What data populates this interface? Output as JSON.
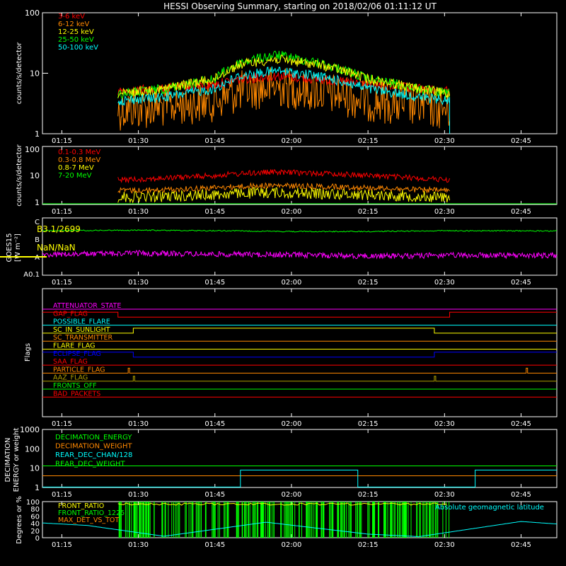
{
  "title": "HESSI Observing Summary, starting on 2018/02/06 01:11:12 UT",
  "time_ticks": [
    "01:15",
    "01:30",
    "01:45",
    "02:00",
    "02:15",
    "02:30",
    "02:45"
  ],
  "colors": {
    "red": "#ff0000",
    "orange": "#ff8800",
    "yellow": "#ffff00",
    "green": "#00ff00",
    "cyan": "#00ffff",
    "magenta": "#ff00ff",
    "blue": "#0000ff",
    "olive": "#b0a000",
    "white": "#ffffff"
  },
  "panel1": {
    "ylabel": "counts/s/detector",
    "yticks": [
      "100",
      "10",
      "1"
    ],
    "legend": [
      {
        "label": "3-6 keV",
        "color": "#ff0000"
      },
      {
        "label": "6-12 keV",
        "color": "#ff8800"
      },
      {
        "label": "12-25 keV",
        "color": "#ffff00"
      },
      {
        "label": "25-50 keV",
        "color": "#00ff00"
      },
      {
        "label": "50-100 keV",
        "color": "#00ffff"
      }
    ]
  },
  "panel2": {
    "ylabel": "counts/s/detector",
    "yticks": [
      "100",
      "10",
      "1"
    ],
    "legend": [
      {
        "label": "0.1-0.3 MeV",
        "color": "#ff0000"
      },
      {
        "label": "0.3-0.8 MeV",
        "color": "#ff8800"
      },
      {
        "label": "0.8-7 MeV",
        "color": "#ffff00"
      },
      {
        "label": "7-20 MeV",
        "color": "#00ff00"
      }
    ]
  },
  "panel3": {
    "ylabel": "GOES15",
    "ylabel2": "[W m⁻²]",
    "yticks": [
      "C",
      "B",
      "A",
      "A0.1"
    ],
    "label1": "B3.1/2699",
    "label2": "NaN/NaN"
  },
  "panel4": {
    "ylabel": "Flags",
    "flags": [
      {
        "label": "ATTENUATOR_STATE",
        "color": "#ff00ff"
      },
      {
        "label": "GAP_FLAG",
        "color": "#ff0000"
      },
      {
        "label": "POSSIBLE_FLARE",
        "color": "#00ffff"
      },
      {
        "label": "SC_IN_SUNLIGHT",
        "color": "#ffff00"
      },
      {
        "label": "SC_TRANSMITTER",
        "color": "#ff8800"
      },
      {
        "label": "FLARE_FLAG",
        "color": "#ffff00"
      },
      {
        "label": "ECLIPSE_FLAG",
        "color": "#0000ff"
      },
      {
        "label": "SAA_FLAG",
        "color": "#ff0000"
      },
      {
        "label": "PARTICLE_FLAG",
        "color": "#ff8800"
      },
      {
        "label": "AAZ_FLAG",
        "color": "#b0a000"
      },
      {
        "label": "FRONTS_OFF",
        "color": "#00ff00"
      },
      {
        "label": "BAD_PACKETS",
        "color": "#ff0000"
      }
    ]
  },
  "panel5": {
    "ylabel": "DECIMATION",
    "ylabel2": "ENERGY or weight",
    "yticks": [
      "1000",
      "100",
      "10",
      "1"
    ],
    "legend": [
      {
        "label": "DECIMATION_ENERGY",
        "color": "#00ff00"
      },
      {
        "label": "DECIMATION_WEIGHT",
        "color": "#ff8800"
      },
      {
        "label": "REAR_DEC_CHAN/128",
        "color": "#00ffff"
      },
      {
        "label": "REAR_DEC_WEIGHT",
        "color": "#00ff00"
      }
    ]
  },
  "panel6": {
    "ylabel": "Degrees or %",
    "yticks": [
      "100",
      "80",
      "60",
      "40",
      "20",
      "0"
    ],
    "legend": [
      {
        "label": "FRONT_RATIO",
        "color": "#ffff00"
      },
      {
        "label": "FRONT_RATIO_1225",
        "color": "#00ff00"
      },
      {
        "label": "MAX_DET_VS_TOT",
        "color": "#ff8800"
      }
    ],
    "legend_right": {
      "label": "Absolute geomagnetic latitude",
      "color": "#00ffff"
    }
  },
  "chart_data": [
    {
      "type": "line",
      "title": "HESSI Observing Summary, starting on 2018/02/06 01:11:12 UT",
      "ylabel": "counts/s/detector",
      "yscale": "log",
      "ylim": [
        1,
        100
      ],
      "xlim": [
        "01:11:12",
        "02:52"
      ],
      "x": [
        "01:26",
        "01:35",
        "01:45",
        "01:50",
        "01:57",
        "02:05",
        "02:15",
        "02:25",
        "02:31"
      ],
      "series": [
        {
          "name": "3-6 keV",
          "values": [
            5,
            5.5,
            6.5,
            8,
            9,
            8,
            6.5,
            5.5,
            5
          ]
        },
        {
          "name": "6-12 keV",
          "values": [
            2.5,
            2.8,
            3.5,
            5,
            6,
            5,
            3.5,
            2.8,
            2.5
          ]
        },
        {
          "name": "12-25 keV",
          "values": [
            4.5,
            5.5,
            8,
            14,
            17,
            14,
            8,
            5.5,
            4.5
          ]
        },
        {
          "name": "25-50 keV",
          "values": [
            4.5,
            5.5,
            8,
            15,
            20,
            15,
            8,
            5.5,
            4.5
          ]
        },
        {
          "name": "50-100 keV",
          "values": [
            3.5,
            4,
            5.5,
            9,
            11,
            9,
            5.5,
            4,
            3.5
          ]
        }
      ]
    },
    {
      "type": "line",
      "ylabel": "counts/s/detector",
      "yscale": "log",
      "ylim": [
        1,
        100
      ],
      "x": [
        "01:26",
        "01:35",
        "01:45",
        "01:55",
        "02:05",
        "02:15",
        "02:25",
        "02:31"
      ],
      "series": [
        {
          "name": "0.1-0.3 MeV",
          "values": [
            7,
            8,
            10,
            13,
            12,
            10,
            8,
            7
          ]
        },
        {
          "name": "0.3-0.8 MeV",
          "values": [
            3,
            3.2,
            3.8,
            4.5,
            4.2,
            3.8,
            3.2,
            3
          ]
        },
        {
          "name": "0.8-7 MeV",
          "values": [
            1.8,
            1.9,
            2.2,
            2.6,
            2.4,
            2.2,
            1.9,
            1.8
          ]
        },
        {
          "name": "7-20 MeV",
          "values": [
            1,
            1,
            1,
            1,
            1,
            1,
            1,
            1
          ]
        }
      ]
    },
    {
      "type": "line",
      "ylabel": "GOES15 [W m⁻²]",
      "yscale": "log",
      "x": [
        "01:11",
        "01:30",
        "01:45",
        "02:00",
        "02:15",
        "02:30",
        "02:52"
      ],
      "series": [
        {
          "values": [
            3e-07,
            3.2e-07,
            3e-07,
            2.7e-07,
            2.7e-07,
            3e-07,
            2.9e-07
          ]
        },
        {
          "values": [
            1.3e-08,
            1.6e-08,
            1.4e-08,
            1.3e-08,
            1.1e-08,
            1.2e-08,
            1.2e-08
          ]
        }
      ]
    },
    {
      "type": "line",
      "ylabel": "Flags",
      "series": [
        {
          "name": "GAP_FLAG",
          "values": "on 01:11-01:26, off 01:26-02:31, on 02:31-02:52"
        },
        {
          "name": "SC_IN_SUNLIGHT",
          "values": "off 01:11-01:29, on 01:29-02:28, off after"
        },
        {
          "name": "ECLIPSE_FLAG",
          "values": "on 01:11-01:29, off 01:29-02:28, on after"
        },
        {
          "name": "PARTICLE_FLAG",
          "values": "spikes 01:28, 02:46"
        },
        {
          "name": "AAZ_FLAG",
          "values": "spikes 01:29, 02:28"
        }
      ]
    },
    {
      "type": "line",
      "ylabel": "DECIMATION ENERGY or weight",
      "yscale": "log",
      "ylim": [
        1,
        1000
      ],
      "series": [
        {
          "name": "DECIMATION_ENERGY",
          "values": [
            0,
            0
          ]
        },
        {
          "name": "DECIMATION_WEIGHT",
          "values": [
            4,
            4
          ]
        },
        {
          "name": "REAR_DEC_CHAN/128",
          "values": "8 during 01:50-02:13 and 02:36-02:52, else 1"
        },
        {
          "name": "REAR_DEC_WEIGHT",
          "values": [
            13,
            13
          ]
        }
      ]
    },
    {
      "type": "line",
      "ylabel": "Degrees or %",
      "ylim": [
        0,
        100
      ],
      "x": [
        "01:11",
        "01:20",
        "01:35",
        "01:55",
        "02:15",
        "02:25",
        "02:45",
        "02:52"
      ],
      "series": [
        {
          "name": "Absolute geomagnetic latitude",
          "values": [
            41,
            34,
            4,
            43,
            10,
            3,
            45,
            38
          ]
        }
      ]
    }
  ]
}
